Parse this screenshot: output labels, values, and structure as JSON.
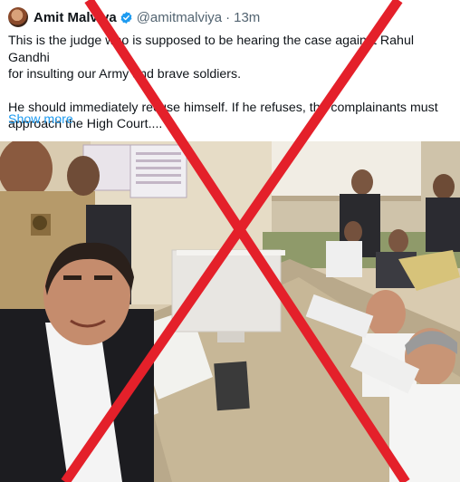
{
  "author": {
    "name": "Amit Malviya",
    "handle": "@amitmalviya",
    "separator": "·",
    "time": "13m",
    "verified_icon": "verified-badge-icon"
  },
  "tweet": {
    "line1": "This is the judge who is supposed to be hearing the case against Rahul Gandhi",
    "line2": "for insulting our Army and brave soldiers.",
    "line3": "He should immediately recuse himself. If he refuses, the complainants must",
    "line4": "approach the High Court....",
    "show_more": "Show more"
  },
  "overlay": {
    "cross_color": "#e4202a"
  },
  "colors": {
    "link": "#1d9bf0",
    "secondary_text": "#536471",
    "verified": "#1d9bf0"
  }
}
